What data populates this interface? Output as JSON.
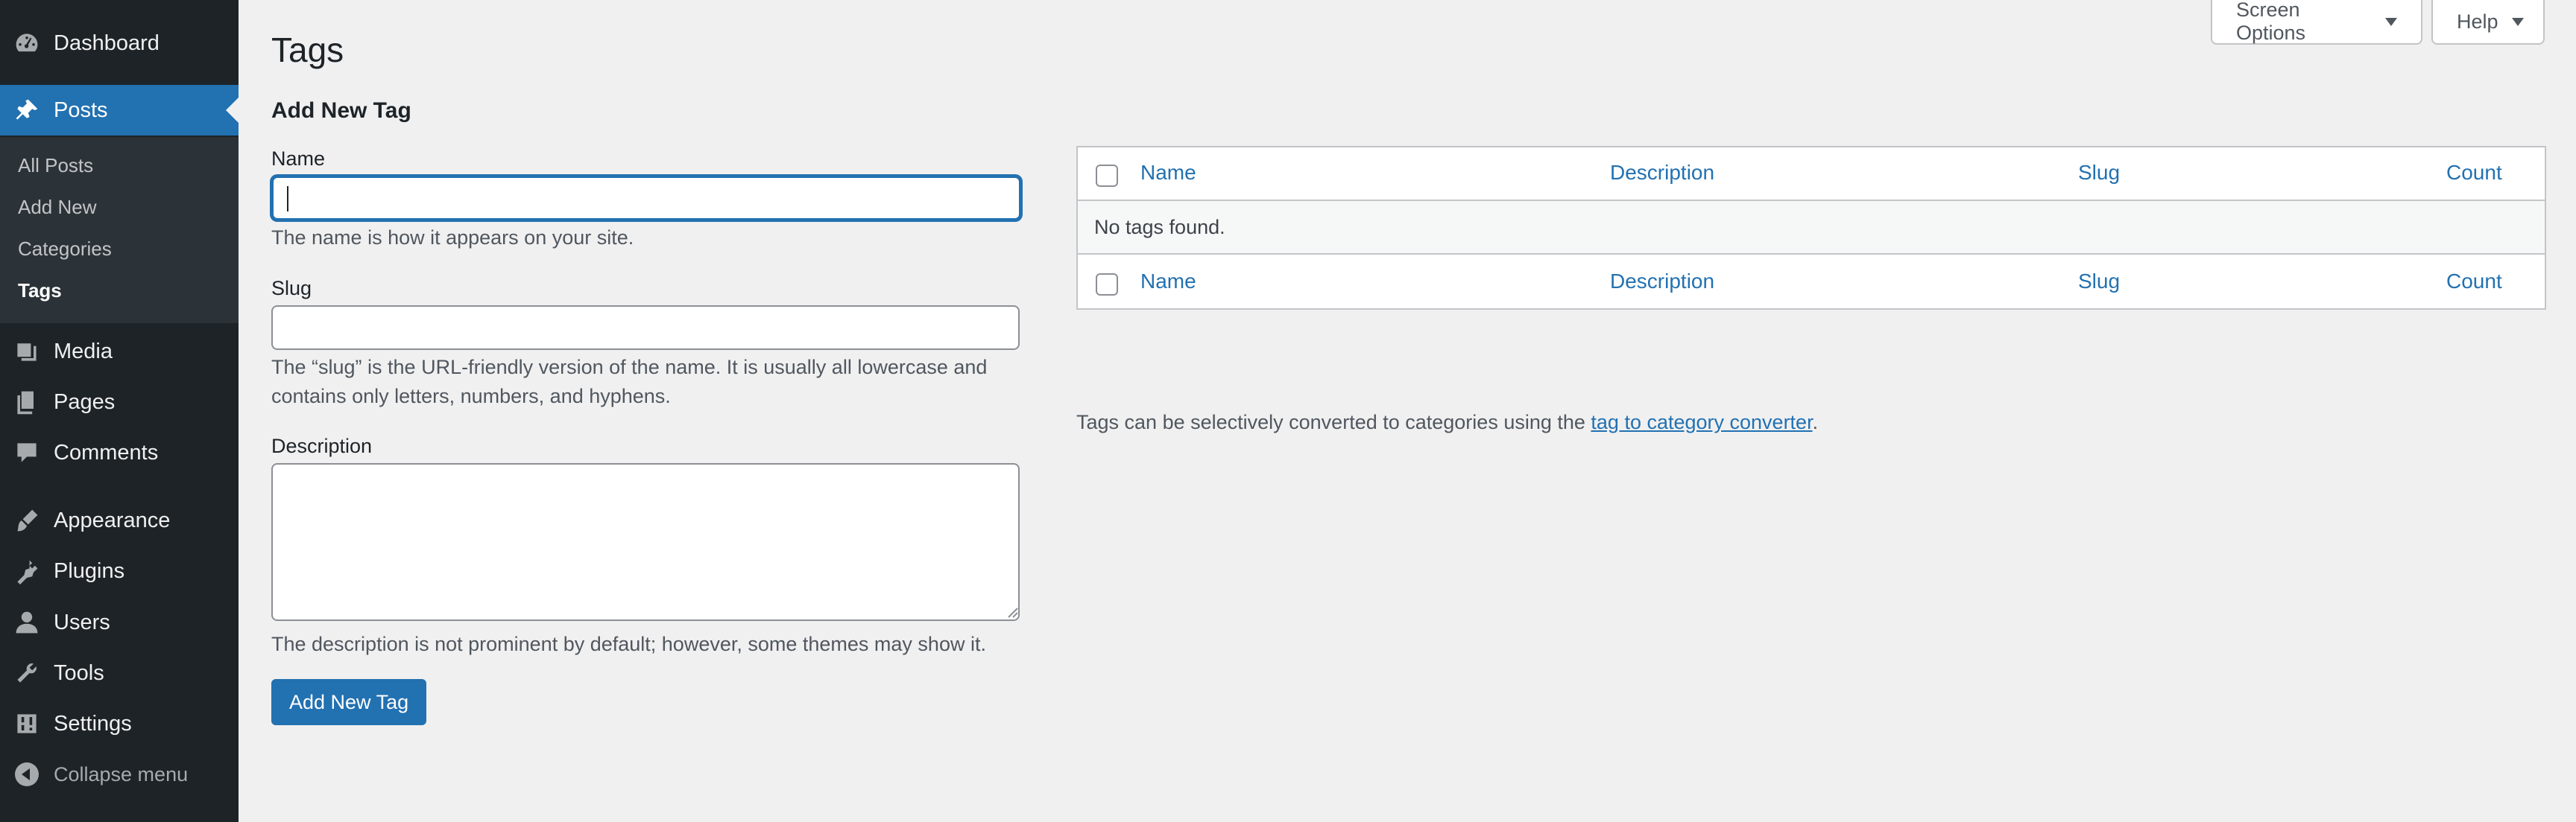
{
  "sidebar": {
    "items": [
      {
        "label": "Dashboard",
        "icon": "dashboard-icon"
      },
      {
        "label": "Posts",
        "icon": "pin-icon",
        "current": true
      },
      {
        "label": "Media",
        "icon": "media-icon"
      },
      {
        "label": "Pages",
        "icon": "pages-icon"
      },
      {
        "label": "Comments",
        "icon": "comment-icon"
      },
      {
        "label": "Appearance",
        "icon": "brush-icon"
      },
      {
        "label": "Plugins",
        "icon": "plug-icon"
      },
      {
        "label": "Users",
        "icon": "user-icon"
      },
      {
        "label": "Tools",
        "icon": "wrench-icon"
      },
      {
        "label": "Settings",
        "icon": "settings-icon"
      }
    ],
    "submenu": [
      {
        "label": "All Posts"
      },
      {
        "label": "Add New"
      },
      {
        "label": "Categories"
      },
      {
        "label": "Tags",
        "current": true
      }
    ],
    "collapse_label": "Collapse menu"
  },
  "header": {
    "screen_options_label": "Screen Options",
    "help_label": "Help"
  },
  "page": {
    "title": "Tags"
  },
  "form": {
    "heading": "Add New Tag",
    "name_label": "Name",
    "name_value": "",
    "name_help": "The name is how it appears on your site.",
    "slug_label": "Slug",
    "slug_value": "",
    "slug_help": "The “slug” is the URL-friendly version of the name. It is usually all lowercase and contains only letters, numbers, and hyphens.",
    "description_label": "Description",
    "description_value": "",
    "description_help": "The description is not prominent by default; however, some themes may show it.",
    "submit_label": "Add New Tag"
  },
  "table": {
    "columns": [
      "Name",
      "Description",
      "Slug",
      "Count"
    ],
    "empty_message": "No tags found."
  },
  "converter": {
    "text_before": "Tags can be selectively converted to categories using the ",
    "link_text": "tag to category converter",
    "text_after": "."
  },
  "colors": {
    "sidebar_bg": "#1d2327",
    "submenu_bg": "#2c3338",
    "accent": "#2271b1",
    "page_bg": "#f0f0f1"
  }
}
